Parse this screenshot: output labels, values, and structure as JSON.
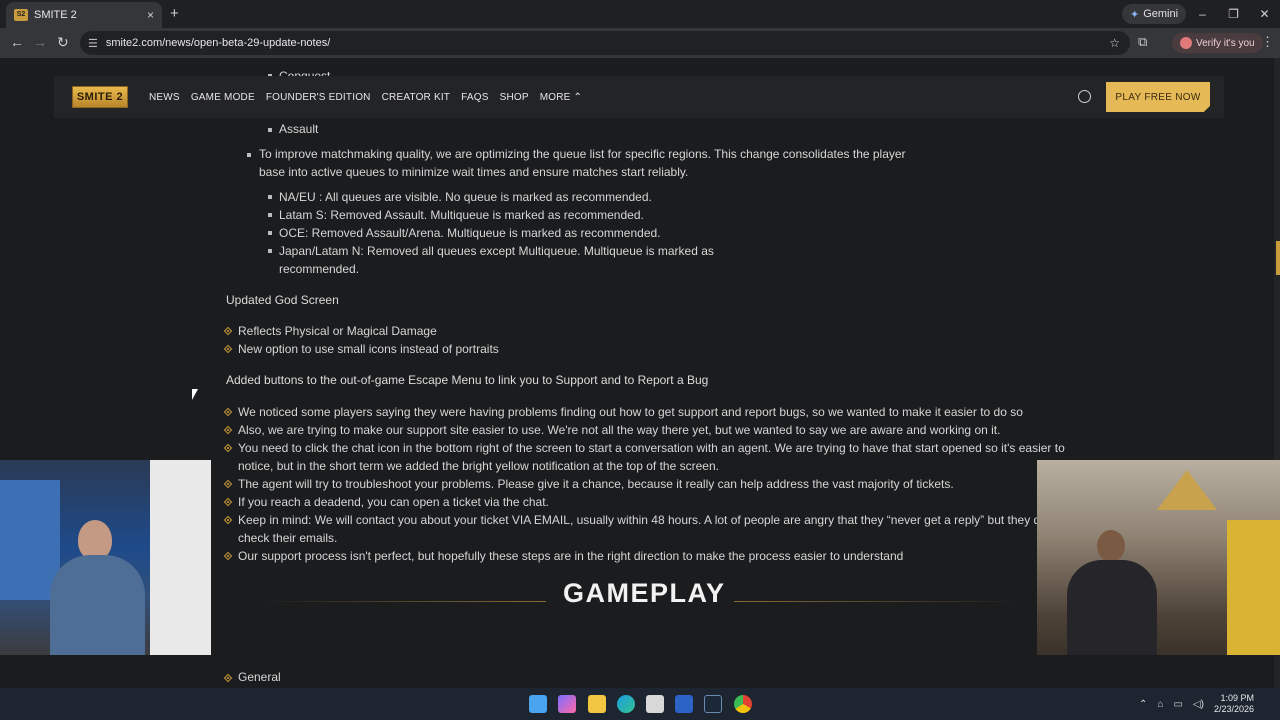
{
  "browser": {
    "tab_title": "SMITE 2",
    "tab_close": "×",
    "new_tab": "+",
    "gemini_label": "Gemini",
    "url": "smite2.com/news/open-beta-29-update-notes/",
    "verify_label": "Verify it's you",
    "window_controls": [
      "–",
      "❐",
      "✕"
    ]
  },
  "site_nav": {
    "logo_text": "SMITE 2",
    "links": [
      "NEWS",
      "GAME MODE",
      "FOUNDER'S EDITION",
      "CREATOR KIT",
      "FAQS",
      "SHOP",
      "MORE ⌃"
    ],
    "play_button": "PLAY FREE NOW"
  },
  "content": {
    "cut_item": "Conquest",
    "assault_item": "Assault",
    "matchmaking_intro_1": "To improve matchmaking quality, we are optimizing the queue list for specific regions. This change consolidates the player",
    "matchmaking_intro_2": "base into active queues to minimize wait times and ensure matches start reliably.",
    "regions": [
      "NA/EU : All queues are visible. No queue is marked as recommended.",
      "Latam S: Removed Assault. Multiqueue is marked as recommended.",
      "OCE: Removed Assault/Arena. Multiqueue is marked as recommended.",
      "Japan/Latam N: Removed all queues except Multiqueue. Multiqueue is marked as",
      "recommended."
    ],
    "god_screen_heading": "Updated God Screen",
    "god_screen_items": [
      "Reflects Physical or Magical Damage",
      "New option to use small icons instead of portraits"
    ],
    "escape_heading": "Added buttons to the out-of-game Escape Menu to link you to Support and to Report a Bug",
    "support_items": [
      "We noticed some players saying they were having problems finding out how to get support and report bugs, so we wanted to make it easier to do so",
      "Also, we are trying to make our support site easier to use. We're not all the way there yet, but we wanted to say we are aware and working on it.",
      "You need to click the chat icon in the bottom right of the screen to start a conversation with an agent. We are trying to have that start opened so it's easier to",
      "notice, but in the short term we added the bright yellow notification at the top of the screen.",
      "The agent will try to troubleshoot your problems. Please give it a chance, because it really can help address the vast majority of tickets.",
      "If you reach a deadend, you can open a ticket via the chat.",
      "Keep in mind: We will contact you about your ticket VIA EMAIL, usually within 48 hours. A lot of people are angry that they “never get a reply” but they don",
      "check their emails.",
      "Our support process isn't perfect, but hopefully these steps are in the right direction to make the process easier to understand"
    ],
    "gameplay_title": "GAMEPLAY",
    "general_item": "General"
  },
  "taskbar": {
    "time": "1:09 PM",
    "date": "2/23/2026"
  }
}
